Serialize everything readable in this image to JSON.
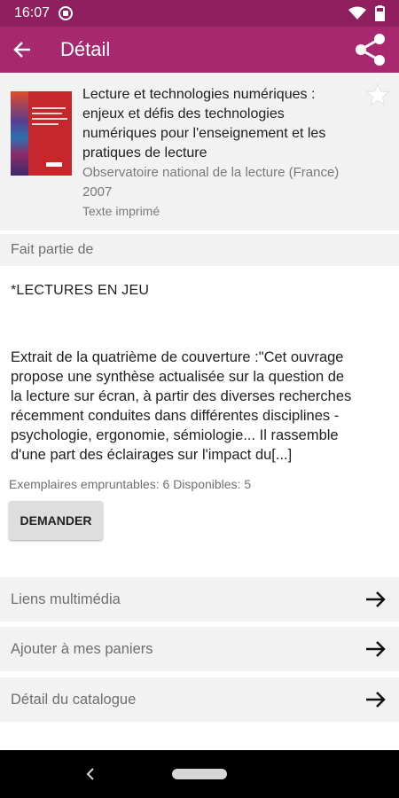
{
  "status_bar": {
    "time": "16:07",
    "icons": [
      "sync-icon",
      "wifi-icon",
      "battery-icon"
    ]
  },
  "app_bar": {
    "title": "Détail",
    "back_icon": "arrow-back-icon",
    "share_icon": "share-icon"
  },
  "record": {
    "title_lines": [
      "Lecture et technologies numériques :",
      "enjeux et défis des technologies",
      "numériques pour l'enseignement et les",
      "pratiques de lecture"
    ],
    "author": "Observatoire national de la lecture (France)",
    "year": "2007",
    "type": "Texte imprimé"
  },
  "section": {
    "label": "Fait partie de",
    "series": "*LECTURES EN JEU"
  },
  "abstract_lines": [
    "Extrait de la quatrième de couverture :\"Cet ouvrage",
    "propose une synthèse actualisée sur la question de",
    "la lecture sur écran, à partir des diverses recherches",
    "récemment conduites dans différentes disciplines -",
    "psychologie, ergonomie, sémiologie... Il rassemble",
    "d'une part des éclairages sur l'impact du[...]"
  ],
  "availability": "Exemplaires empruntables: 6  Disponibles: 5",
  "request_button": "DEMANDER",
  "links": [
    {
      "label": "Liens multimédia"
    },
    {
      "label": "Ajouter à mes paniers"
    },
    {
      "label": "Détail du catalogue"
    }
  ],
  "colors": {
    "status_bar": "#8f1f5f",
    "app_bar": "#a8286f"
  }
}
